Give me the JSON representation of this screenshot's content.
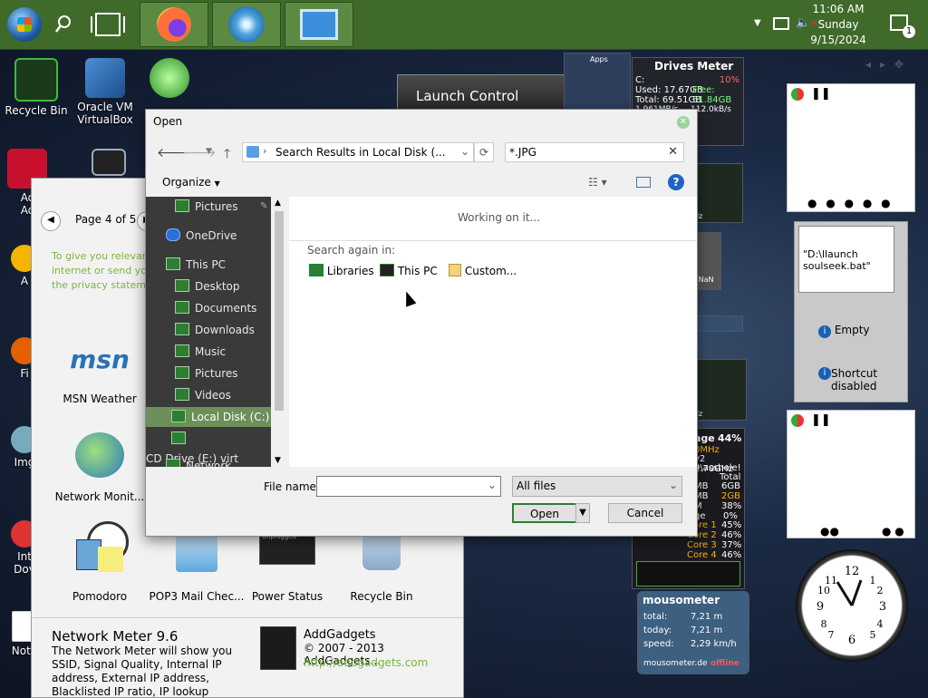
{
  "taskbar": {
    "time": "11:06 AM",
    "day": "Sunday",
    "date": "9/15/2024",
    "notif_count": "1"
  },
  "desktop_icons": {
    "recycle_bin": "Recycle Bin",
    "virtualbox": "Oracle VM VirtualBox",
    "ac_label": "Ac",
    "ac_label2": "Ac",
    "a_label": "A",
    "fi_label": "Fi",
    "img_label": "Img",
    "int_label": "Int",
    "dov_label": "Dov",
    "note_label": "Note"
  },
  "launch_control": {
    "title": "Launch Control"
  },
  "drives_meter": {
    "title": "Drives Meter",
    "drive": "C:",
    "percent": "10%",
    "used": "Used: 17.67GB",
    "free": "Free: 51.84GB",
    "total": "Total: 69.51GB",
    "rate_left": "1.961MB/s",
    "rate_right": "112.0kB/s",
    "apps_label": "Apps"
  },
  "gadget_window": {
    "page_label": "Page 4 of 5",
    "privacy_text_1": "To give you relevant",
    "privacy_text_2": "internet or send you",
    "privacy_text_3": "the privacy stateme",
    "gadgets": [
      {
        "name": "MSN Weather"
      },
      {
        "name": "Network Monit..."
      },
      {
        "name": "Pomodoro"
      },
      {
        "name": "POP3 Mail Chec..."
      },
      {
        "name": "Power Status"
      },
      {
        "name": "Recycle Bin"
      }
    ],
    "detail_title": "Network Meter 9.6",
    "detail_text": "The Network Meter will show you SSID, Signal Quality, Internal IP address, External IP address, Blacklisted IP ratio, IP lookup with",
    "publisher": "AddGadgets",
    "copyright": "© 2007 - 2013 AddGadgets...",
    "url": "http://addgadgets.com",
    "msn_logo": "msn",
    "power_status_label": "Unplugged"
  },
  "dialog": {
    "title": "Open",
    "address": "Search Results in Local Disk (...",
    "search_value": "*.JPG",
    "organize_label": "Organize",
    "working": "Working on it...",
    "search_again": "Search again in:",
    "search_locations": [
      "Libraries",
      "This PC",
      "Custom..."
    ],
    "nav": [
      "Pictures",
      "OneDrive",
      "This PC",
      "Desktop",
      "Documents",
      "Downloads",
      "Music",
      "Pictures",
      "Videos",
      "Local Disk (C:)",
      "CD Drive (E:) virt",
      "Network"
    ],
    "file_name_label": "File name:",
    "file_name_value": "",
    "file_type": "All files",
    "open_label": "Open",
    "cancel_label": "Cancel"
  },
  "right_panel": {
    "launch_text": "\"D:\\llaunch soulseek.bat\"",
    "empty_label": "Empty",
    "shortcut_label": "Shortcut disabled"
  },
  "cpu_gadget": {
    "usage_label": "age",
    "usage_pct": "44%",
    "mhz": "0MHz",
    "cpu_info": "v2 2.70GHz",
    "asshole": "9\\asshole!",
    "total_label": "Total",
    "mb_label": "MB",
    "gb_label": "6GB",
    "mb2": "MB",
    "gb2": "2GB",
    "m_label": "M",
    "pct38": "38%",
    "e_label": "ge",
    "pct0": "0%",
    "cores": [
      {
        "name": "Core 1",
        "pct": "45%"
      },
      {
        "name": "Core 2",
        "pct": "46%"
      },
      {
        "name": "Core 3",
        "pct": "37%"
      },
      {
        "name": "Core 4",
        "pct": "46%"
      }
    ],
    "ghz1": "Hz",
    "ghz2": "Hz",
    "nan_label": "d NaN"
  },
  "mousometer": {
    "title": "mousometer",
    "total_label": "total:",
    "total_value": "7,21 m",
    "today_label": "today:",
    "today_value": "7,21 m",
    "speed_label": "speed:",
    "speed_value": "2,29 km/h",
    "site": "mousometer.de",
    "offline": "offline"
  },
  "colors": {
    "taskbar": "#3f6a2a",
    "nav_bg": "#3a3a3a",
    "nav_selected": "#6d8f5a",
    "open_button_border": "#2e7d32"
  }
}
